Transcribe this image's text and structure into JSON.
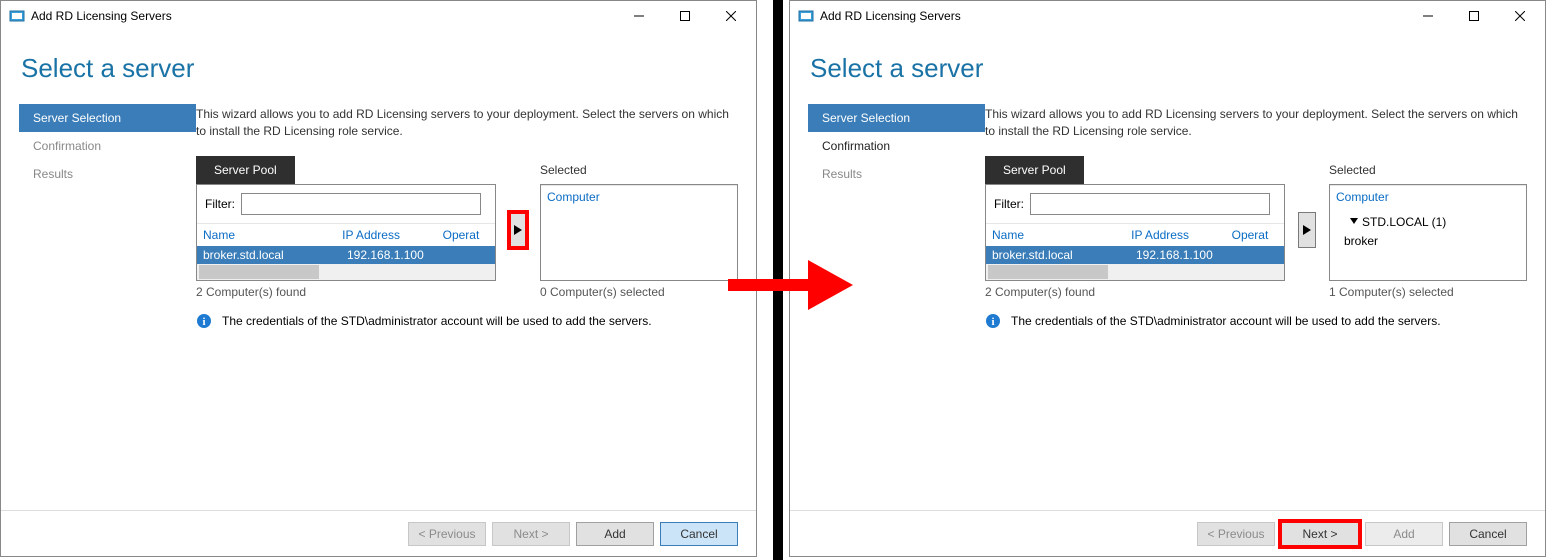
{
  "title": "Add RD Licensing Servers",
  "page_title": "Select a server",
  "nav": {
    "items": [
      "Server Selection",
      "Confirmation",
      "Results"
    ]
  },
  "instructions": "This wizard allows you to add RD Licensing servers to your deployment. Select the servers on which to install the RD Licensing role service.",
  "pool_tab": "Server Pool",
  "selected_label": "Selected",
  "filter_label": "Filter:",
  "columns": {
    "name": "Name",
    "ip": "IP Address",
    "os": "Operat"
  },
  "selected_columns": {
    "computer": "Computer"
  },
  "servers": [
    {
      "name": "broker.std.local",
      "ip": "192.168.1.100"
    }
  ],
  "right_selected": {
    "domain": "STD.LOCAL (1)",
    "children": [
      "broker"
    ]
  },
  "left_status": "2 Computer(s) found",
  "left_selected_status": "0 Computer(s) selected",
  "right_status": "2 Computer(s) found",
  "right_selected_status": "1 Computer(s) selected",
  "info_text": "The credentials of the STD\\administrator account will be used to add the servers.",
  "buttons": {
    "previous": "< Previous",
    "next": "Next >",
    "add": "Add",
    "cancel": "Cancel"
  }
}
